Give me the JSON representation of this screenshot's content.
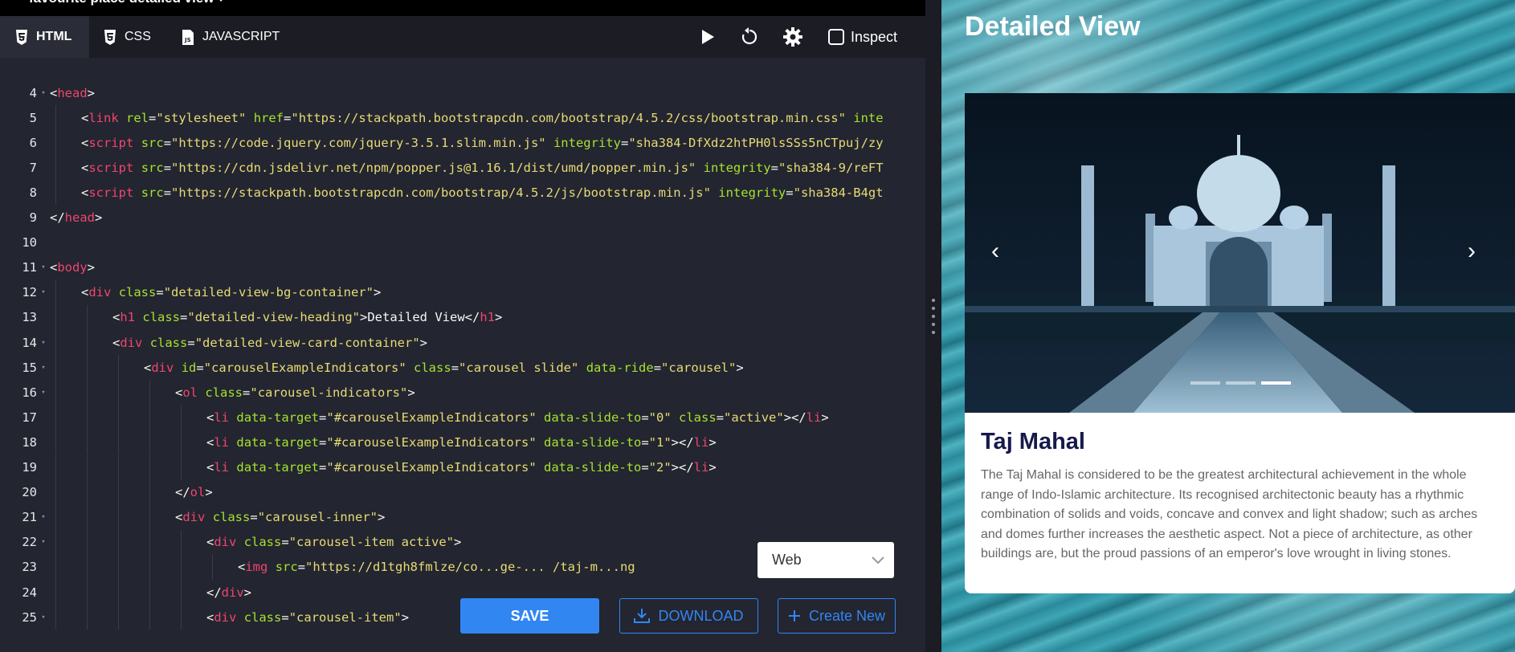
{
  "top_title": "favourite place detailed view ↗",
  "tabs": [
    {
      "label": "HTML",
      "icon": "html5-icon",
      "active": true
    },
    {
      "label": "CSS",
      "icon": "css3-icon",
      "active": false
    },
    {
      "label": "JAVASCRIPT",
      "icon": "js-file-icon",
      "active": false
    }
  ],
  "controls": {
    "inspect_label": "Inspect"
  },
  "code_lines": [
    {
      "n": "4",
      "fold": true,
      "indent": 0,
      "html": "<span class='pl'>&lt;</span><span class='tg'>head</span><span class='pl'>&gt;</span>"
    },
    {
      "n": "5",
      "fold": false,
      "indent": 1,
      "html": "<span class='pl'>&lt;</span><span class='tg'>link</span> <span class='at'>rel</span><span class='pl'>=</span><span class='st'>\"stylesheet\"</span> <span class='at'>href</span><span class='pl'>=</span><span class='st'>\"https://stackpath.bootstrapcdn.com/bootstrap/4.5.2/css/bootstrap.min.css\"</span> <span class='at'>inte</span>"
    },
    {
      "n": "6",
      "fold": false,
      "indent": 1,
      "html": "<span class='pl'>&lt;</span><span class='tg'>script</span> <span class='at'>src</span><span class='pl'>=</span><span class='st'>\"https://code.jquery.com/jquery-3.5.1.slim.min.js\"</span> <span class='at'>integrity</span><span class='pl'>=</span><span class='st'>\"sha384-DfXdz2htPH0lsSSs5nCTpuj/zy</span>"
    },
    {
      "n": "7",
      "fold": false,
      "indent": 1,
      "html": "<span class='pl'>&lt;</span><span class='tg'>script</span> <span class='at'>src</span><span class='pl'>=</span><span class='st'>\"https://cdn.jsdelivr.net/npm/popper.js@1.16.1/dist/umd/popper.min.js\"</span> <span class='at'>integrity</span><span class='pl'>=</span><span class='st'>\"sha384-9/reFT</span>"
    },
    {
      "n": "8",
      "fold": false,
      "indent": 1,
      "html": "<span class='pl'>&lt;</span><span class='tg'>script</span> <span class='at'>src</span><span class='pl'>=</span><span class='st'>\"https://stackpath.bootstrapcdn.com/bootstrap/4.5.2/js/bootstrap.min.js\"</span> <span class='at'>integrity</span><span class='pl'>=</span><span class='st'>\"sha384-B4gt</span>"
    },
    {
      "n": "9",
      "fold": false,
      "indent": 0,
      "html": "<span class='pl'>&lt;/</span><span class='tg'>head</span><span class='pl'>&gt;</span>"
    },
    {
      "n": "10",
      "fold": false,
      "indent": 0,
      "html": ""
    },
    {
      "n": "11",
      "fold": true,
      "indent": 0,
      "html": "<span class='pl'>&lt;</span><span class='tg'>body</span><span class='pl'>&gt;</span>"
    },
    {
      "n": "12",
      "fold": true,
      "indent": 1,
      "html": "<span class='pl'>&lt;</span><span class='tg'>div</span> <span class='at'>class</span><span class='pl'>=</span><span class='st'>\"detailed-view-bg-container\"</span><span class='pl'>&gt;</span>"
    },
    {
      "n": "13",
      "fold": false,
      "indent": 2,
      "html": "<span class='pl'>&lt;</span><span class='tg'>h1</span> <span class='at'>class</span><span class='pl'>=</span><span class='st'>\"detailed-view-heading\"</span><span class='pl'>&gt;Detailed View&lt;/</span><span class='tg'>h1</span><span class='pl'>&gt;</span>"
    },
    {
      "n": "14",
      "fold": true,
      "indent": 2,
      "html": "<span class='pl'>&lt;</span><span class='tg'>div</span> <span class='at'>class</span><span class='pl'>=</span><span class='st'>\"detailed-view-card-container\"</span><span class='pl'>&gt;</span>"
    },
    {
      "n": "15",
      "fold": true,
      "indent": 3,
      "html": "<span class='pl'>&lt;</span><span class='tg'>div</span> <span class='at'>id</span><span class='pl'>=</span><span class='st'>\"carouselExampleIndicators\"</span> <span class='at'>class</span><span class='pl'>=</span><span class='st'>\"carousel slide\"</span> <span class='at'>data-ride</span><span class='pl'>=</span><span class='st'>\"carousel\"</span><span class='pl'>&gt;</span>"
    },
    {
      "n": "16",
      "fold": true,
      "indent": 4,
      "html": "<span class='pl'>&lt;</span><span class='tg'>ol</span> <span class='at'>class</span><span class='pl'>=</span><span class='st'>\"carousel-indicators\"</span><span class='pl'>&gt;</span>"
    },
    {
      "n": "17",
      "fold": false,
      "indent": 5,
      "html": "<span class='pl'>&lt;</span><span class='tg'>li</span> <span class='at'>data-target</span><span class='pl'>=</span><span class='st'>\"#carouselExampleIndicators\"</span> <span class='at'>data-slide-to</span><span class='pl'>=</span><span class='st'>\"0\"</span> <span class='at'>class</span><span class='pl'>=</span><span class='st'>\"active\"</span><span class='pl'>&gt;&lt;/</span><span class='tg'>li</span><span class='pl'>&gt;</span>"
    },
    {
      "n": "18",
      "fold": false,
      "indent": 5,
      "html": "<span class='pl'>&lt;</span><span class='tg'>li</span> <span class='at'>data-target</span><span class='pl'>=</span><span class='st'>\"#carouselExampleIndicators\"</span> <span class='at'>data-slide-to</span><span class='pl'>=</span><span class='st'>\"1\"</span><span class='pl'>&gt;&lt;/</span><span class='tg'>li</span><span class='pl'>&gt;</span>"
    },
    {
      "n": "19",
      "fold": false,
      "indent": 5,
      "html": "<span class='pl'>&lt;</span><span class='tg'>li</span> <span class='at'>data-target</span><span class='pl'>=</span><span class='st'>\"#carouselExampleIndicators\"</span> <span class='at'>data-slide-to</span><span class='pl'>=</span><span class='st'>\"2\"</span><span class='pl'>&gt;&lt;/</span><span class='tg'>li</span><span class='pl'>&gt;</span>"
    },
    {
      "n": "20",
      "fold": false,
      "indent": 4,
      "html": "<span class='pl'>&lt;/</span><span class='tg'>ol</span><span class='pl'>&gt;</span>"
    },
    {
      "n": "21",
      "fold": true,
      "indent": 4,
      "html": "<span class='pl'>&lt;</span><span class='tg'>div</span> <span class='at'>class</span><span class='pl'>=</span><span class='st'>\"carousel-inner\"</span><span class='pl'>&gt;</span>"
    },
    {
      "n": "22",
      "fold": true,
      "indent": 5,
      "html": "<span class='pl'>&lt;</span><span class='tg'>div</span> <span class='at'>class</span><span class='pl'>=</span><span class='st'>\"carousel-item active\"</span><span class='pl'>&gt;</span>"
    },
    {
      "n": "23",
      "fold": false,
      "indent": 6,
      "html": "<span class='pl'>&lt;</span><span class='tg'>img</span> <span class='at'>src</span><span class='pl'>=</span><span class='st'>\"https://d1tgh8fmlze</span>"
    },
    {
      "n": "24",
      "fold": false,
      "indent": 5,
      "html": "<span class='pl'>&lt;/</span><span class='tg'>div</span><span class='pl'>&gt;</span>"
    },
    {
      "n": "25",
      "fold": true,
      "indent": 5,
      "html": "<span class='pl'>&lt;</span><span class='tg'>div</span> <span class='at'>class</span><span class='pl'>=</span><span class='st'>\"carousel-item\"</span><span class='pl'>&gt;</span>"
    }
  ],
  "code_tail_23": "/co...ge-... /taj-m...ng",
  "preview_select": {
    "value": "Web"
  },
  "buttons": {
    "save": "SAVE",
    "download": "DOWNLOAD",
    "create_new": "Create New"
  },
  "preview": {
    "heading": "Detailed View",
    "carousel": {
      "slides": 3,
      "active_index": 2
    },
    "card_title": "Taj Mahal",
    "card_text": "The Taj Mahal is considered to be the greatest architectural achievement in the whole range of Indo-Islamic architecture. Its recognised architectonic beauty has a rhythmic combination of solids and voids, concave and convex and light shadow; such as arches and domes further increases the aesthetic aspect. Not a piece of architecture, as other buildings are, but the proud passions of an emperor's love wrought in living stones."
  },
  "colors": {
    "editor_bg": "#232530",
    "tabbar_bg": "#1b1c24",
    "tag": "#f0456e",
    "attr": "#a6e22e",
    "string": "#e6db74",
    "accent_blue": "#3286f2",
    "card_title": "#161a4a"
  }
}
